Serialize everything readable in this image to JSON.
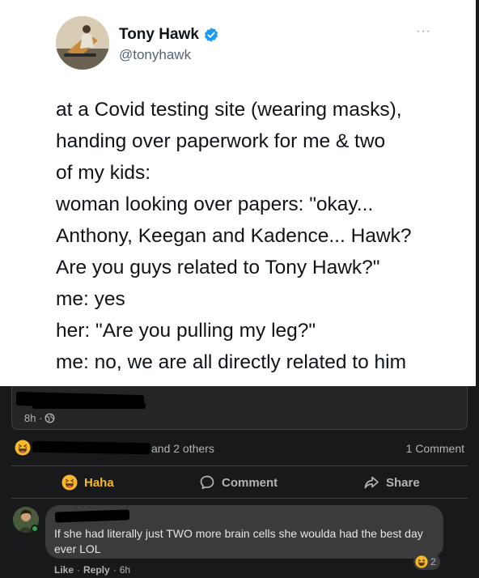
{
  "tweet": {
    "author_name": "Tony Hawk",
    "author_handle": "@tonyhawk",
    "more_label": "···",
    "lines": [
      "at a Covid testing site (wearing masks),",
      "handing over paperwork for me & two",
      "of my kids:",
      "woman looking over papers: \"okay...",
      "Anthony, Keegan and Kadence... Hawk?",
      "Are you guys related to Tony Hawk?\"",
      "me: yes",
      "her: \"Are you pulling my leg?\"",
      "me: no, we are all directly related to him"
    ]
  },
  "post": {
    "time": "8h ·",
    "reactions_others": "and 2 others",
    "comment_count": "1 Comment",
    "actions": {
      "haha": "Haha",
      "comment": "Comment",
      "share": "Share"
    }
  },
  "comment": {
    "text": "If she had literally just TWO more brain cells she woulda had the best day ever LOL",
    "reaction_count": "2",
    "like_label": "Like",
    "reply_label": "Reply",
    "separator": "·",
    "age": "6h"
  },
  "colors": {
    "background": "#18191a",
    "haha_accent": "#f7b928",
    "verified_blue": "#1d9bf0",
    "online_green": "#31a24c"
  },
  "icons": [
    "verified-badge-icon",
    "globe-icon",
    "haha-emoji-icon",
    "comment-icon",
    "share-icon"
  ]
}
